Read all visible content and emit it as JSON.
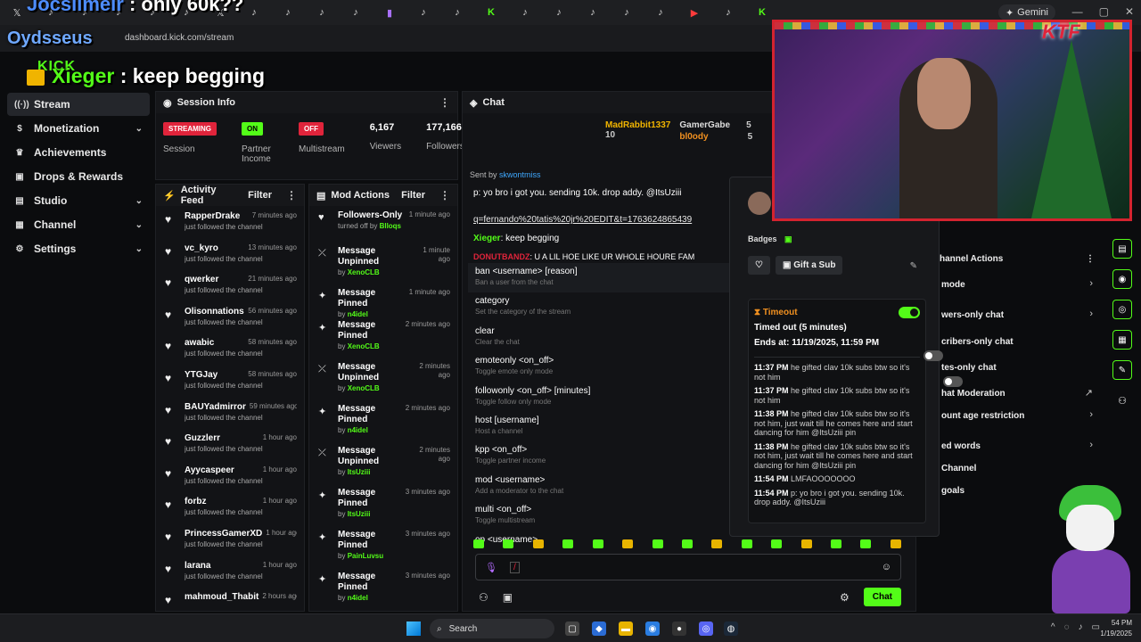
{
  "browser": {
    "url": "dashboard.kick.com/stream",
    "gemini_label": "Gemini",
    "tab_icons": [
      "x-icon",
      "tiktok-icon",
      "tiktok-icon",
      "tiktok-icon",
      "tiktok-icon",
      "tiktok-icon",
      "x-icon",
      "tiktok-icon",
      "tiktok-icon",
      "tiktok-icon",
      "tiktok-icon",
      "twitch-icon",
      "tiktok-icon",
      "tiktok-icon",
      "kick-icon",
      "tiktok-icon",
      "tiktok-icon",
      "tiktok-icon",
      "tiktok-icon",
      "tiktok-icon",
      "youtube-icon",
      "tiktok-icon",
      "kick-icon"
    ]
  },
  "overlay": {
    "top_user": "Jocsilmeir",
    "top_text": " : only 60k??",
    "mid_text": "Oydsseus",
    "main_user": "Xieger",
    "main_text": " : keep begging",
    "logo": "KICK"
  },
  "sidebar": {
    "items": [
      {
        "label": "Stream",
        "icon": "stream-icon",
        "chevron": false,
        "active": true
      },
      {
        "label": "Monetization",
        "icon": "dollar-icon",
        "chevron": true,
        "active": false
      },
      {
        "label": "Achievements",
        "icon": "trophy-icon",
        "chevron": false,
        "active": false
      },
      {
        "label": "Drops & Rewards",
        "icon": "gift-icon",
        "chevron": false,
        "active": false
      },
      {
        "label": "Studio",
        "icon": "studio-icon",
        "chevron": true,
        "active": false
      },
      {
        "label": "Channel",
        "icon": "channel-icon",
        "chevron": true,
        "active": false
      },
      {
        "label": "Settings",
        "icon": "gear-icon",
        "chevron": true,
        "active": false
      }
    ]
  },
  "session": {
    "title": "Session Info",
    "stats": [
      {
        "value": "STREAMING",
        "label": "Session",
        "kind": "badge-red"
      },
      {
        "value": "ON",
        "label": "Partner Income",
        "kind": "badge-green"
      },
      {
        "value": "OFF",
        "label": "Multistream",
        "kind": "badge-red"
      },
      {
        "value": "6,167",
        "label": "Viewers",
        "kind": "num"
      },
      {
        "value": "177,166",
        "label": "Followers",
        "kind": "num"
      }
    ]
  },
  "activity_feed": {
    "title": "Activity Feed",
    "filter": "Filter",
    "items": [
      {
        "name": "RapperDrake",
        "time": "7 minutes ago",
        "sub": "just followed the channel"
      },
      {
        "name": "vc_kyro",
        "time": "13 minutes ago",
        "sub": "just followed the channel"
      },
      {
        "name": "qwerker",
        "time": "21 minutes ago",
        "sub": "just followed the channel"
      },
      {
        "name": "Olisonnations",
        "time": "56 minutes ago",
        "sub": "just followed the channel"
      },
      {
        "name": "awabic",
        "time": "58 minutes ago",
        "sub": "just followed the channel"
      },
      {
        "name": "YTGJay",
        "time": "58 minutes ago",
        "sub": "just followed the channel"
      },
      {
        "name": "BAUYadmirror",
        "time": "59 minutes ago",
        "sub": "just followed the channel"
      },
      {
        "name": "Guzzlerr",
        "time": "1 hour ago",
        "sub": "just followed the channel"
      },
      {
        "name": "Ayycaspeer",
        "time": "1 hour ago",
        "sub": "just followed the channel"
      },
      {
        "name": "forbz",
        "time": "1 hour ago",
        "sub": "just followed the channel"
      },
      {
        "name": "PrincessGamerXD",
        "time": "1 hour ago",
        "sub": "just followed the channel"
      },
      {
        "name": "larana",
        "time": "1 hour ago",
        "sub": "just followed the channel"
      },
      {
        "name": "mahmoud_Thabit",
        "time": "2 hours ago",
        "sub": ""
      }
    ]
  },
  "mod_actions": {
    "title": "Mod Actions",
    "filter": "Filter",
    "items": [
      {
        "name": "Followers-Only",
        "time": "1 minute ago",
        "sub": "turned off by",
        "by": "Blloqs",
        "icon": "heart-icon",
        "h": 40
      },
      {
        "name": "Message Unpinned",
        "time": "1 minute ago",
        "sub": "by",
        "by": "XenoCLB",
        "icon": "unpin-icon",
        "h": 47
      },
      {
        "name": "Message Pinned",
        "time": "1 minute ago",
        "sub": "by",
        "by": "n4idel",
        "icon": "pin-icon",
        "h": 36
      },
      {
        "name": "Message Pinned",
        "time": "2 minutes ago",
        "sub": "by",
        "by": "XenoCLB",
        "icon": "pin-icon",
        "h": 47
      },
      {
        "name": "Message Unpinned",
        "time": "2 minutes ago",
        "sub": "by",
        "by": "XenoCLB",
        "icon": "unpin-icon",
        "h": 47
      },
      {
        "name": "Message Pinned",
        "time": "2 minutes ago",
        "sub": "by",
        "by": "n4idel",
        "icon": "pin-icon",
        "h": 47
      },
      {
        "name": "Message Unpinned",
        "time": "2 minutes ago",
        "sub": "by",
        "by": "ItsUziii",
        "icon": "unpin-icon",
        "h": 47
      },
      {
        "name": "Message Pinned",
        "time": "3 minutes ago",
        "sub": "by",
        "by": "ItsUziii",
        "icon": "pin-icon",
        "h": 47
      },
      {
        "name": "Message Pinned",
        "time": "3 minutes ago",
        "sub": "by",
        "by": "PainLuvsu",
        "icon": "pin-icon",
        "h": 47
      },
      {
        "name": "Message Pinned",
        "time": "3 minutes ago",
        "sub": "by",
        "by": "n4idel",
        "icon": "pin-icon",
        "h": 40
      }
    ]
  },
  "chat": {
    "title": "Chat",
    "top_gifters": [
      {
        "name": "MadRabbit1337",
        "count": "10"
      },
      {
        "name": "GamerGabe",
        "count": "5"
      },
      {
        "name": "bl0ody",
        "count": "5"
      }
    ],
    "sent_by_label": "Sent by",
    "sent_by_user": "skwontmiss",
    "reply_text": "p: yo bro i got you. sending 10k. drop addy. @ItsUziii",
    "link_text": "q=fernando%20tatis%20jr%20EDIT&t=1763624865439",
    "msg1_user": "Xieger",
    "msg1_text": ": keep begging",
    "msg2_user": "DONUTBANDZ",
    "msg2_text": ": U A LIL HOE LIKE UR WHOLE HOURE FAM",
    "commands": [
      {
        "name": "ban <username> [reason]",
        "desc": "Ban a user from the chat"
      },
      {
        "name": "category",
        "desc": "Set the category of the stream"
      },
      {
        "name": "clear",
        "desc": "Clear the chat"
      },
      {
        "name": "emoteonly <on_off>",
        "desc": "Toggle emote only mode"
      },
      {
        "name": "followonly <on_off> [minutes]",
        "desc": "Toggle follow only mode"
      },
      {
        "name": "host [username]",
        "desc": "Host a channel"
      },
      {
        "name": "kpp <on_off>",
        "desc": "Toggle partner income"
      },
      {
        "name": "mod <username>",
        "desc": "Add a moderator to the chat"
      },
      {
        "name": "multi <on_off>",
        "desc": "Toggle multistream"
      },
      {
        "name": "op <username>",
        "desc": ""
      }
    ],
    "input_value": "/",
    "send_label": "Chat"
  },
  "user_card": {
    "badges_label": "Badges",
    "gift_label": "Gift a Sub",
    "timeout_title": "Timeout",
    "timeout_status": "Timed out (5 minutes)",
    "timeout_ends": "Ends at: 11/19/2025, 11:59 PM",
    "history": [
      {
        "time": "11:37 PM",
        "text": "he gifted clav 10k subs btw so it's not him"
      },
      {
        "time": "11:37 PM",
        "text": "he gifted clav 10k subs btw so it's not him"
      },
      {
        "time": "11:38 PM",
        "text": "he gifted clav 10k subs btw so it's not him, just wait till he comes here and start dancing for him @ItsUziii pin"
      },
      {
        "time": "11:38 PM",
        "text": "he gifted clav 10k subs btw so it's not him, just wait till he comes here and start dancing for him @ItsUziii pin"
      },
      {
        "time": "11:54 PM",
        "text": "LMFAOOOOOOO"
      },
      {
        "time": "11:54 PM",
        "text": "p: yo bro i got you. sending 10k. drop addy. @ItsUziii"
      }
    ]
  },
  "channel_actions": {
    "title": "hannel Actions",
    "items": [
      {
        "label": "mode",
        "right": "chevron"
      },
      {
        "label": "wers-only chat",
        "right": "chevron"
      },
      {
        "label": "cribers-only chat",
        "right": "toggle"
      },
      {
        "label": "tes-only chat",
        "right": "toggle"
      },
      {
        "label": "hat Moderation",
        "right": "chart"
      },
      {
        "label": "ount age restriction",
        "right": "chevron"
      },
      {
        "label": "ed words",
        "right": "chevron"
      },
      {
        "label": "Channel",
        "right": ""
      },
      {
        "label": "goals",
        "right": ""
      }
    ]
  },
  "webcam": {
    "overlay_text": "KTF"
  },
  "taskbar": {
    "search_label": "Search",
    "clock_time": "54 PM",
    "clock_date": "1/19/2025"
  },
  "colors": {
    "accent": "#53fc18",
    "streaming": "#e0243b",
    "timeout": "#f09020"
  }
}
